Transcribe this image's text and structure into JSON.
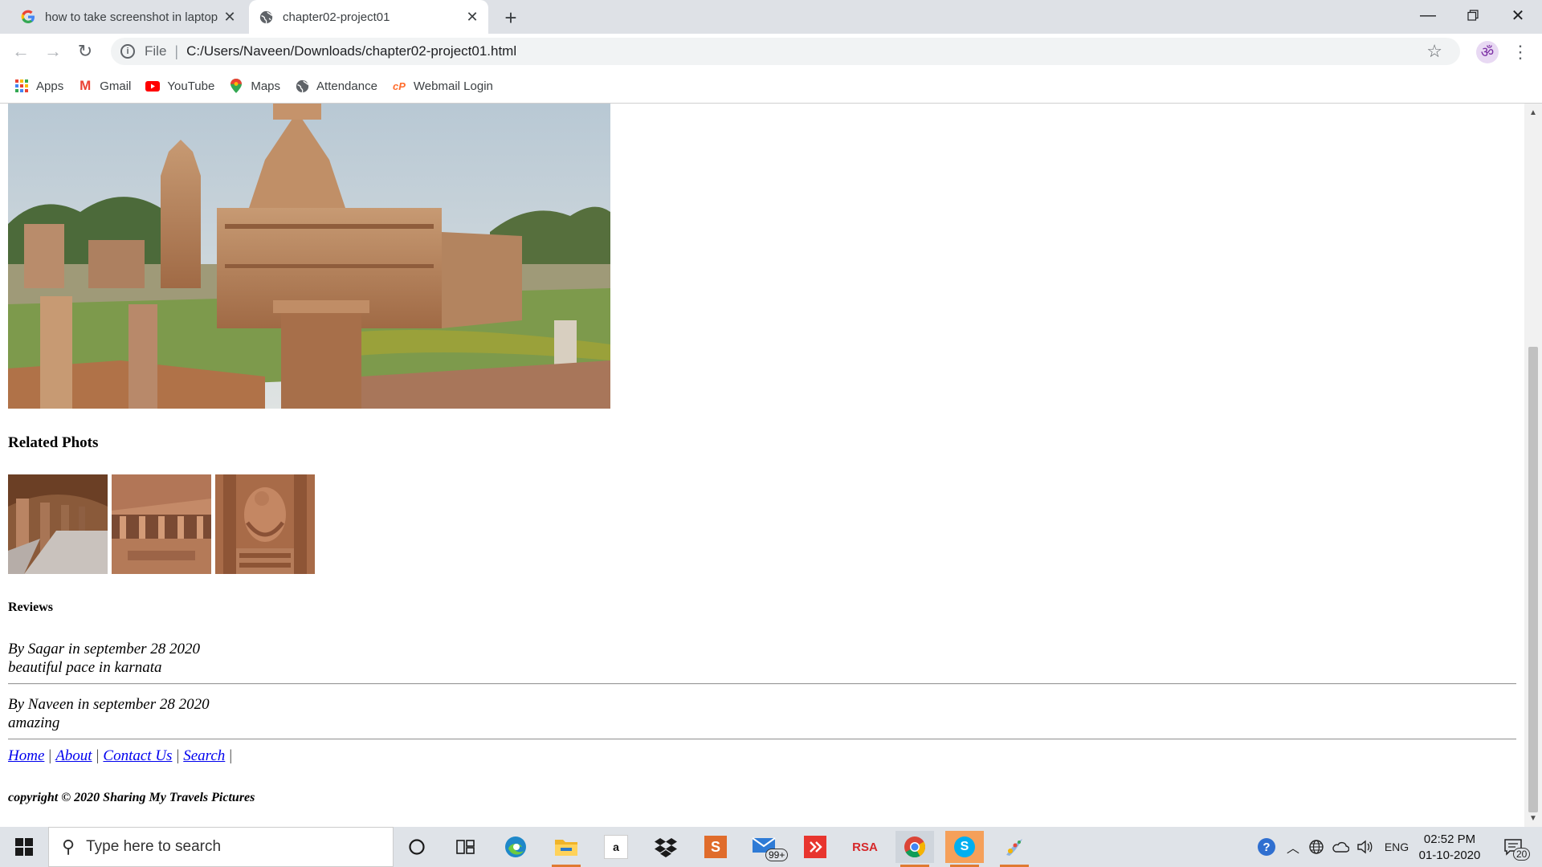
{
  "browser": {
    "tabs": [
      {
        "title": "how to take screenshot in laptop",
        "active": false
      },
      {
        "title": "chapter02-project01",
        "active": true
      }
    ],
    "new_tab": "+",
    "scheme_label": "File",
    "url": "C:/Users/Naveen/Downloads/chapter02-project01.html",
    "bookmarks": [
      {
        "label": "Apps",
        "icon": "apps-grid-icon"
      },
      {
        "label": "Gmail",
        "icon": "gmail-icon"
      },
      {
        "label": "YouTube",
        "icon": "youtube-icon"
      },
      {
        "label": "Maps",
        "icon": "maps-icon"
      },
      {
        "label": "Attendance",
        "icon": "globe-icon"
      },
      {
        "label": "Webmail Login",
        "icon": "cpanel-icon"
      }
    ]
  },
  "page": {
    "related_heading": "Related Phots",
    "reviews_heading": "Reviews",
    "reviews": [
      {
        "byline": "By Sagar in september 28 2020",
        "text": "beautiful pace in karnata"
      },
      {
        "byline": "By Naveen in september 28 2020",
        "text": "amazing"
      }
    ],
    "footer_links": [
      "Home",
      "About",
      "Contact Us",
      "Search"
    ],
    "copyright": "copyright © 2020 Sharing My Travels Pictures"
  },
  "taskbar": {
    "search_placeholder": "Type here to search",
    "mail_badge": "99+",
    "rsa_label": "RSA",
    "language": "ENG",
    "time": "02:52 PM",
    "date": "01-10-2020",
    "notifications": "20"
  },
  "colors": {
    "link": "#0000ee",
    "tabstrip": "#dee1e6",
    "taskbar": "#dfe3e8"
  }
}
